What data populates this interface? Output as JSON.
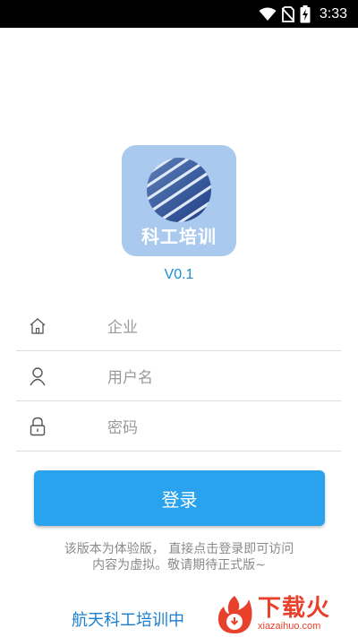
{
  "status_bar": {
    "time": "3:33",
    "icons": [
      "wifi-icon",
      "no-sim-icon",
      "battery-charging-icon"
    ]
  },
  "app": {
    "logo_text": "科工培训",
    "version": "V0.1"
  },
  "form": {
    "company_placeholder": "企业",
    "username_placeholder": "用户名",
    "password_placeholder": "密码",
    "icons": [
      "home-icon",
      "user-icon",
      "lock-icon"
    ]
  },
  "login_button": "登录",
  "notice": {
    "line1": "该版本为体验版，  直接点击登录即可访问",
    "line2": "内容为虚拟。敬请期待正式版~"
  },
  "footer": {
    "title": "航天科工培训中"
  },
  "watermark": {
    "brand": "下载火",
    "url": "xiazaihuo.com"
  },
  "colors": {
    "accent": "#2aa3ef",
    "version": "#1a8fd8",
    "logo_bg": "#a9c9ee",
    "watermark": "#e8402a"
  }
}
